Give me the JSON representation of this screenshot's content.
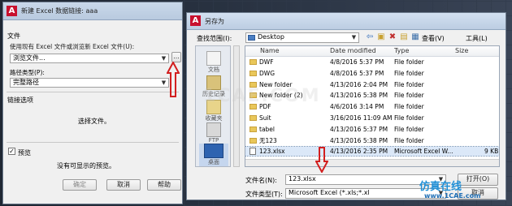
{
  "left_dialog": {
    "title": "新建 Excel 数据链接: aaa",
    "file_group": "文件",
    "use_file_label": "使用现有 Excel 文件或浏览新 Excel 文件(U):",
    "file_value": "浏览文件...",
    "browse_button": "...",
    "path_type_label": "路径类型(P):",
    "path_type_value": "完整路径",
    "link_options_label": "链接选项",
    "select_file_msg": "选择文件。",
    "preview_label": "预览",
    "preview_checked": true,
    "no_preview_msg": "没有可显示的预览。",
    "ok": "确定",
    "cancel": "取消",
    "help": "帮助"
  },
  "right_dialog": {
    "title": "另存为",
    "look_in_label": "查找范围(I):",
    "look_in_value": "Desktop",
    "views_label": "查看(V)",
    "tools_label": "工具(L)",
    "places": [
      {
        "label": "文档",
        "icon": "documents-icon"
      },
      {
        "label": "历史记录",
        "icon": "history-icon"
      },
      {
        "label": "收藏夹",
        "icon": "favorites-icon"
      },
      {
        "label": "FTP",
        "icon": "ftp-icon"
      },
      {
        "label": "桌面",
        "icon": "desktop-icon"
      }
    ],
    "columns": [
      "Name",
      "Date modified",
      "Type",
      "Size"
    ],
    "files": [
      {
        "name": "DWF",
        "date": "4/8/2016 5:37 PM",
        "type": "File folder",
        "size": "",
        "icon": "folder-icon"
      },
      {
        "name": "DWG",
        "date": "4/8/2016 5:37 PM",
        "type": "File folder",
        "size": "",
        "icon": "folder-icon"
      },
      {
        "name": "New folder",
        "date": "4/13/2016 2:04 PM",
        "type": "File folder",
        "size": "",
        "icon": "folder-icon"
      },
      {
        "name": "New folder (2)",
        "date": "4/13/2016 5:38 PM",
        "type": "File folder",
        "size": "",
        "icon": "folder-icon"
      },
      {
        "name": "PDF",
        "date": "4/6/2016 3:14 PM",
        "type": "File folder",
        "size": "",
        "icon": "folder-icon"
      },
      {
        "name": "Suit",
        "date": "3/16/2016 11:09 AM",
        "type": "File folder",
        "size": "",
        "icon": "folder-icon"
      },
      {
        "name": "tabel",
        "date": "4/13/2016 5:37 PM",
        "type": "File folder",
        "size": "",
        "icon": "folder-icon"
      },
      {
        "name": "无123",
        "date": "4/13/2016 5:38 PM",
        "type": "File folder",
        "size": "",
        "icon": "folder-icon"
      },
      {
        "name": "123.xlsx",
        "date": "4/13/2016 2:35 PM",
        "type": "Microsoft Excel W...",
        "size": "9 KB",
        "icon": "excel-file-icon"
      }
    ],
    "filename_label": "文件名(N):",
    "filename_value": "123.xlsx",
    "filetype_label": "文件类型(T):",
    "filetype_value": "Microsoft Excel (*.xls;*.xl",
    "open_button": "打开(O)",
    "cancel_button": "取消"
  },
  "watermarks": {
    "center": "1CAE.COM",
    "brand": "仿真在线",
    "site": "www.1CAE.com"
  },
  "colors": {
    "app_red": "#c8102e",
    "arrow_red": "#d21f1f",
    "selection": "#dbe8f8"
  }
}
